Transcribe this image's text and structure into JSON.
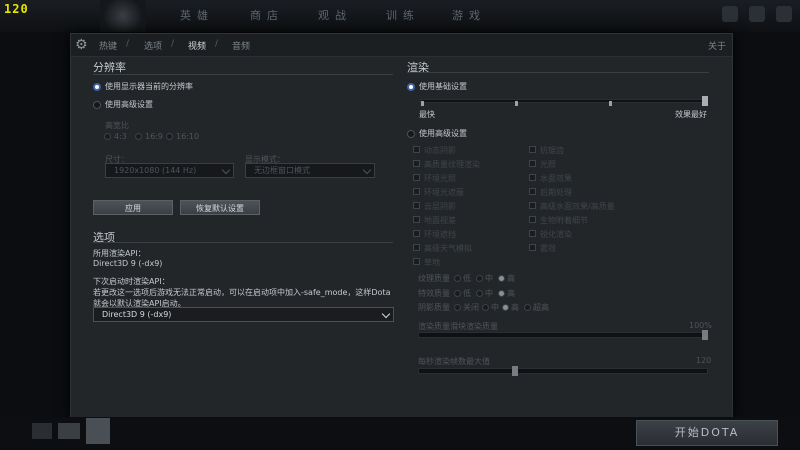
{
  "fps_counter": "120",
  "top_nav": [
    "英雄",
    "商店",
    "观战",
    "训练",
    "游戏"
  ],
  "dialog": {
    "tabs": [
      "热键",
      "选项",
      "视频",
      "音频"
    ],
    "active_tab": "视频",
    "close_label": "关于",
    "resolution": {
      "title": "分辨率",
      "use_monitor_label": "使用显示器当前的分辨率",
      "use_advanced_label": "使用高级设置",
      "aspect_label": "高宽比",
      "aspect_options": [
        "4:3",
        "16:9",
        "16:10"
      ],
      "size_label": "尺寸：",
      "size_value": "1920x1080 (144 Hz)",
      "mode_label": "显示模式：",
      "mode_value": "无边框窗口模式",
      "apply_label": "应用",
      "reset_label": "恢复默认设置"
    },
    "options": {
      "title": "选项",
      "current_api_label": "所用渲染API：",
      "current_api_value": "Direct3D 9 (-dx9)",
      "next_api_label": "下次启动时渲染API：",
      "note": "若更改这一选项后游戏无法正常启动，可以在启动项中加入-safe_mode，这样Dota就会以默认渲染API启动。",
      "api_select_value": "Direct3D 9 (-dx9)"
    },
    "render": {
      "title": "渲染",
      "use_basic_label": "使用基础设置",
      "quality_min_label": "最快",
      "quality_max_label": "效果最好",
      "quality_level": 1.0,
      "use_advanced_label": "使用高级设置",
      "checkboxes_left": [
        "动态阴影",
        "高质量纹理渲染",
        "环境光照",
        "环境光遮蔽",
        "云层阴影",
        "地面视差",
        "环境遮挡",
        "高级天气模拟",
        "草地"
      ],
      "checkboxes_right": [
        "抗锯齿",
        "光照",
        "水面效果",
        "后期处理",
        "高级水面效果/高质量",
        "生物附着细节",
        "锐化渲染",
        "雾效"
      ],
      "texture_label": "纹理质量",
      "effects_label": "特效质量",
      "shadow_label": "阴影质量",
      "level_options": [
        "低",
        "中",
        "高"
      ],
      "shadow_options": [
        "关闭",
        "中",
        "高",
        "超高"
      ],
      "render_quality_label": "渲染质量滑块渲染质量",
      "render_quality_value": "100%",
      "fps_label": "每秒渲染帧数最大值",
      "fps_value": "120"
    }
  },
  "bottom": {
    "play_label": "开始DOTA"
  }
}
